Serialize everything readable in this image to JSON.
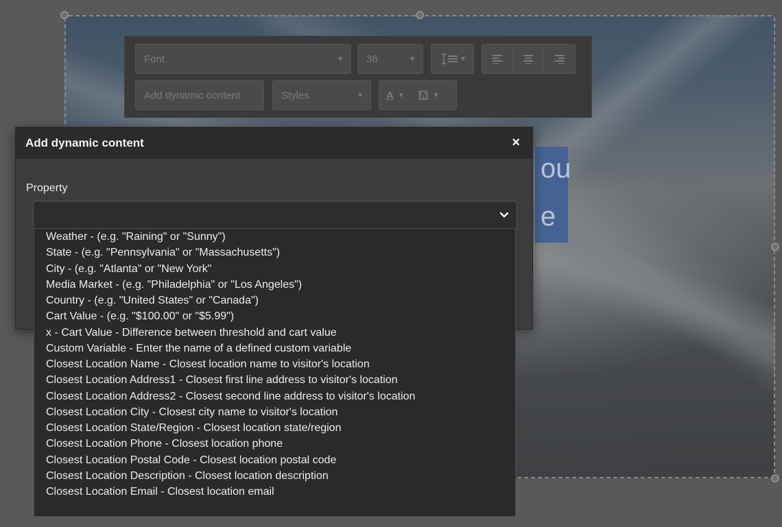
{
  "toolbar": {
    "font_label": "Font",
    "size_value": "36",
    "dynamic_button": "Add dynamic content",
    "styles_label": "Styles"
  },
  "hero": {
    "line1": "ou",
    "line2": "e"
  },
  "modal": {
    "title": "Add dynamic content",
    "close": "×",
    "property_label": "Property",
    "select_value": ""
  },
  "dropdown": {
    "options": [
      "Weather - (e.g. \"Raining\" or \"Sunny\")",
      "State - (e.g. \"Pennsylvania\" or \"Massachusetts\")",
      "City - (e.g. \"Atlanta\" or \"New York\"",
      "Media Market - (e.g. \"Philadelphia\" or \"Los Angeles\")",
      "Country - (e.g. \"United States\" or \"Canada\")",
      "Cart Value - (e.g. \"$100.00\" or \"$5.99\")",
      "x - Cart Value - Difference between threshold and cart value",
      "Custom Variable - Enter the name of a defined custom variable",
      "Closest Location Name - Closest location name to visitor's location",
      "Closest Location Address1 - Closest first line address to visitor's location",
      "Closest Location Address2 - Closest second line address to visitor's location",
      "Closest Location City - Closest city name to visitor's location",
      "Closest Location State/Region - Closest location state/region",
      "Closest Location Phone - Closest location phone",
      "Closest Location Postal Code - Closest location postal code",
      "Closest Location Description - Closest location description",
      "Closest Location Email - Closest location email"
    ]
  },
  "colors": {
    "backdrop": "#595959",
    "modal_header": "#2b2b2b",
    "modal_body": "#3c3c3c",
    "dropdown_bg": "#2a2a2a",
    "text": "#ececec",
    "hero_text_highlight": "#3c5e97"
  },
  "icons": {
    "close": "close-icon",
    "select_chevron": "chevron-down-icon",
    "line_height": "line-height-icon",
    "align_left": "align-left-icon",
    "align_center": "align-center-icon",
    "align_right": "align-right-icon",
    "font_color": "font-color-icon",
    "highlight_color": "highlight-color-icon"
  }
}
